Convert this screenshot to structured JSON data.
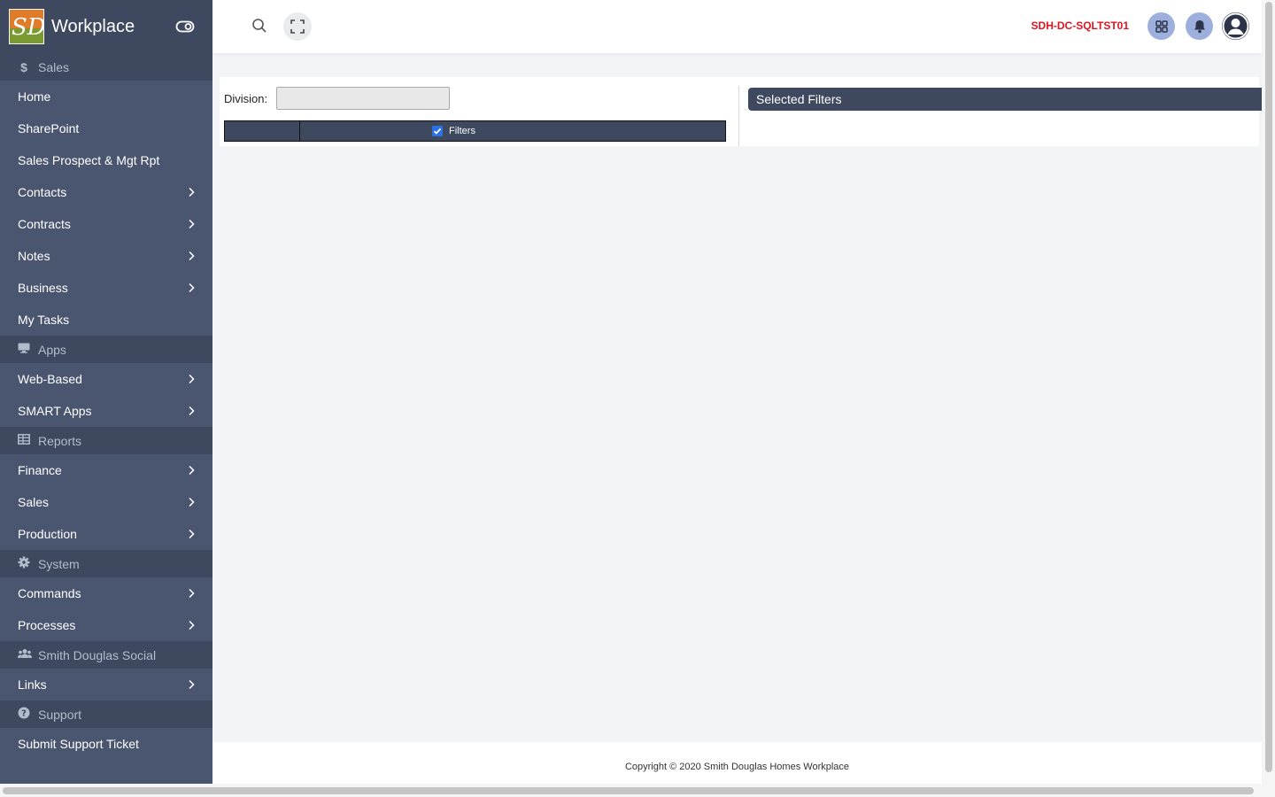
{
  "brand": {
    "logo_text": "SD",
    "name": "Workplace"
  },
  "sidebar": {
    "groups": [
      {
        "section": "Sales",
        "icon": "dollar-icon",
        "items": [
          {
            "label": "Home",
            "has_submenu": false
          },
          {
            "label": "SharePoint",
            "has_submenu": false
          },
          {
            "label": "Sales Prospect & Mgt Rpt",
            "has_submenu": false
          },
          {
            "label": "Contacts",
            "has_submenu": true
          },
          {
            "label": "Contracts",
            "has_submenu": true
          },
          {
            "label": "Notes",
            "has_submenu": true
          },
          {
            "label": "Business",
            "has_submenu": true
          },
          {
            "label": "My Tasks",
            "has_submenu": false
          }
        ]
      },
      {
        "section": "Apps",
        "icon": "monitor-icon",
        "items": [
          {
            "label": "Web-Based",
            "has_submenu": true
          },
          {
            "label": "SMART Apps",
            "has_submenu": true
          }
        ]
      },
      {
        "section": "Reports",
        "icon": "table-icon",
        "items": [
          {
            "label": "Finance",
            "has_submenu": true
          },
          {
            "label": "Sales",
            "has_submenu": true
          },
          {
            "label": "Production",
            "has_submenu": true
          }
        ]
      },
      {
        "section": "System",
        "icon": "gear-icon",
        "items": [
          {
            "label": "Commands",
            "has_submenu": true
          },
          {
            "label": "Processes",
            "has_submenu": true
          }
        ]
      },
      {
        "section": "Smith Douglas Social",
        "icon": "users-icon",
        "items": [
          {
            "label": "Links",
            "has_submenu": true
          }
        ]
      },
      {
        "section": "Support",
        "icon": "question-icon",
        "items": [
          {
            "label": "Submit Support Ticket",
            "has_submenu": false
          }
        ]
      }
    ]
  },
  "topbar": {
    "server_name": "SDH-DC-SQLTST01"
  },
  "filters": {
    "division_label": "Division:",
    "division_value": "",
    "filters_label": "Filters",
    "filters_checked": true,
    "selected_header": "Selected Filters"
  },
  "footer": {
    "copyright": "Copyright © 2020 Smith Douglas Homes Workplace"
  },
  "colors": {
    "sidebar_bg": "#4a5670",
    "section_bg": "#3e4960",
    "server_text": "#e0141e",
    "accent_circle": "#9dafdc"
  }
}
